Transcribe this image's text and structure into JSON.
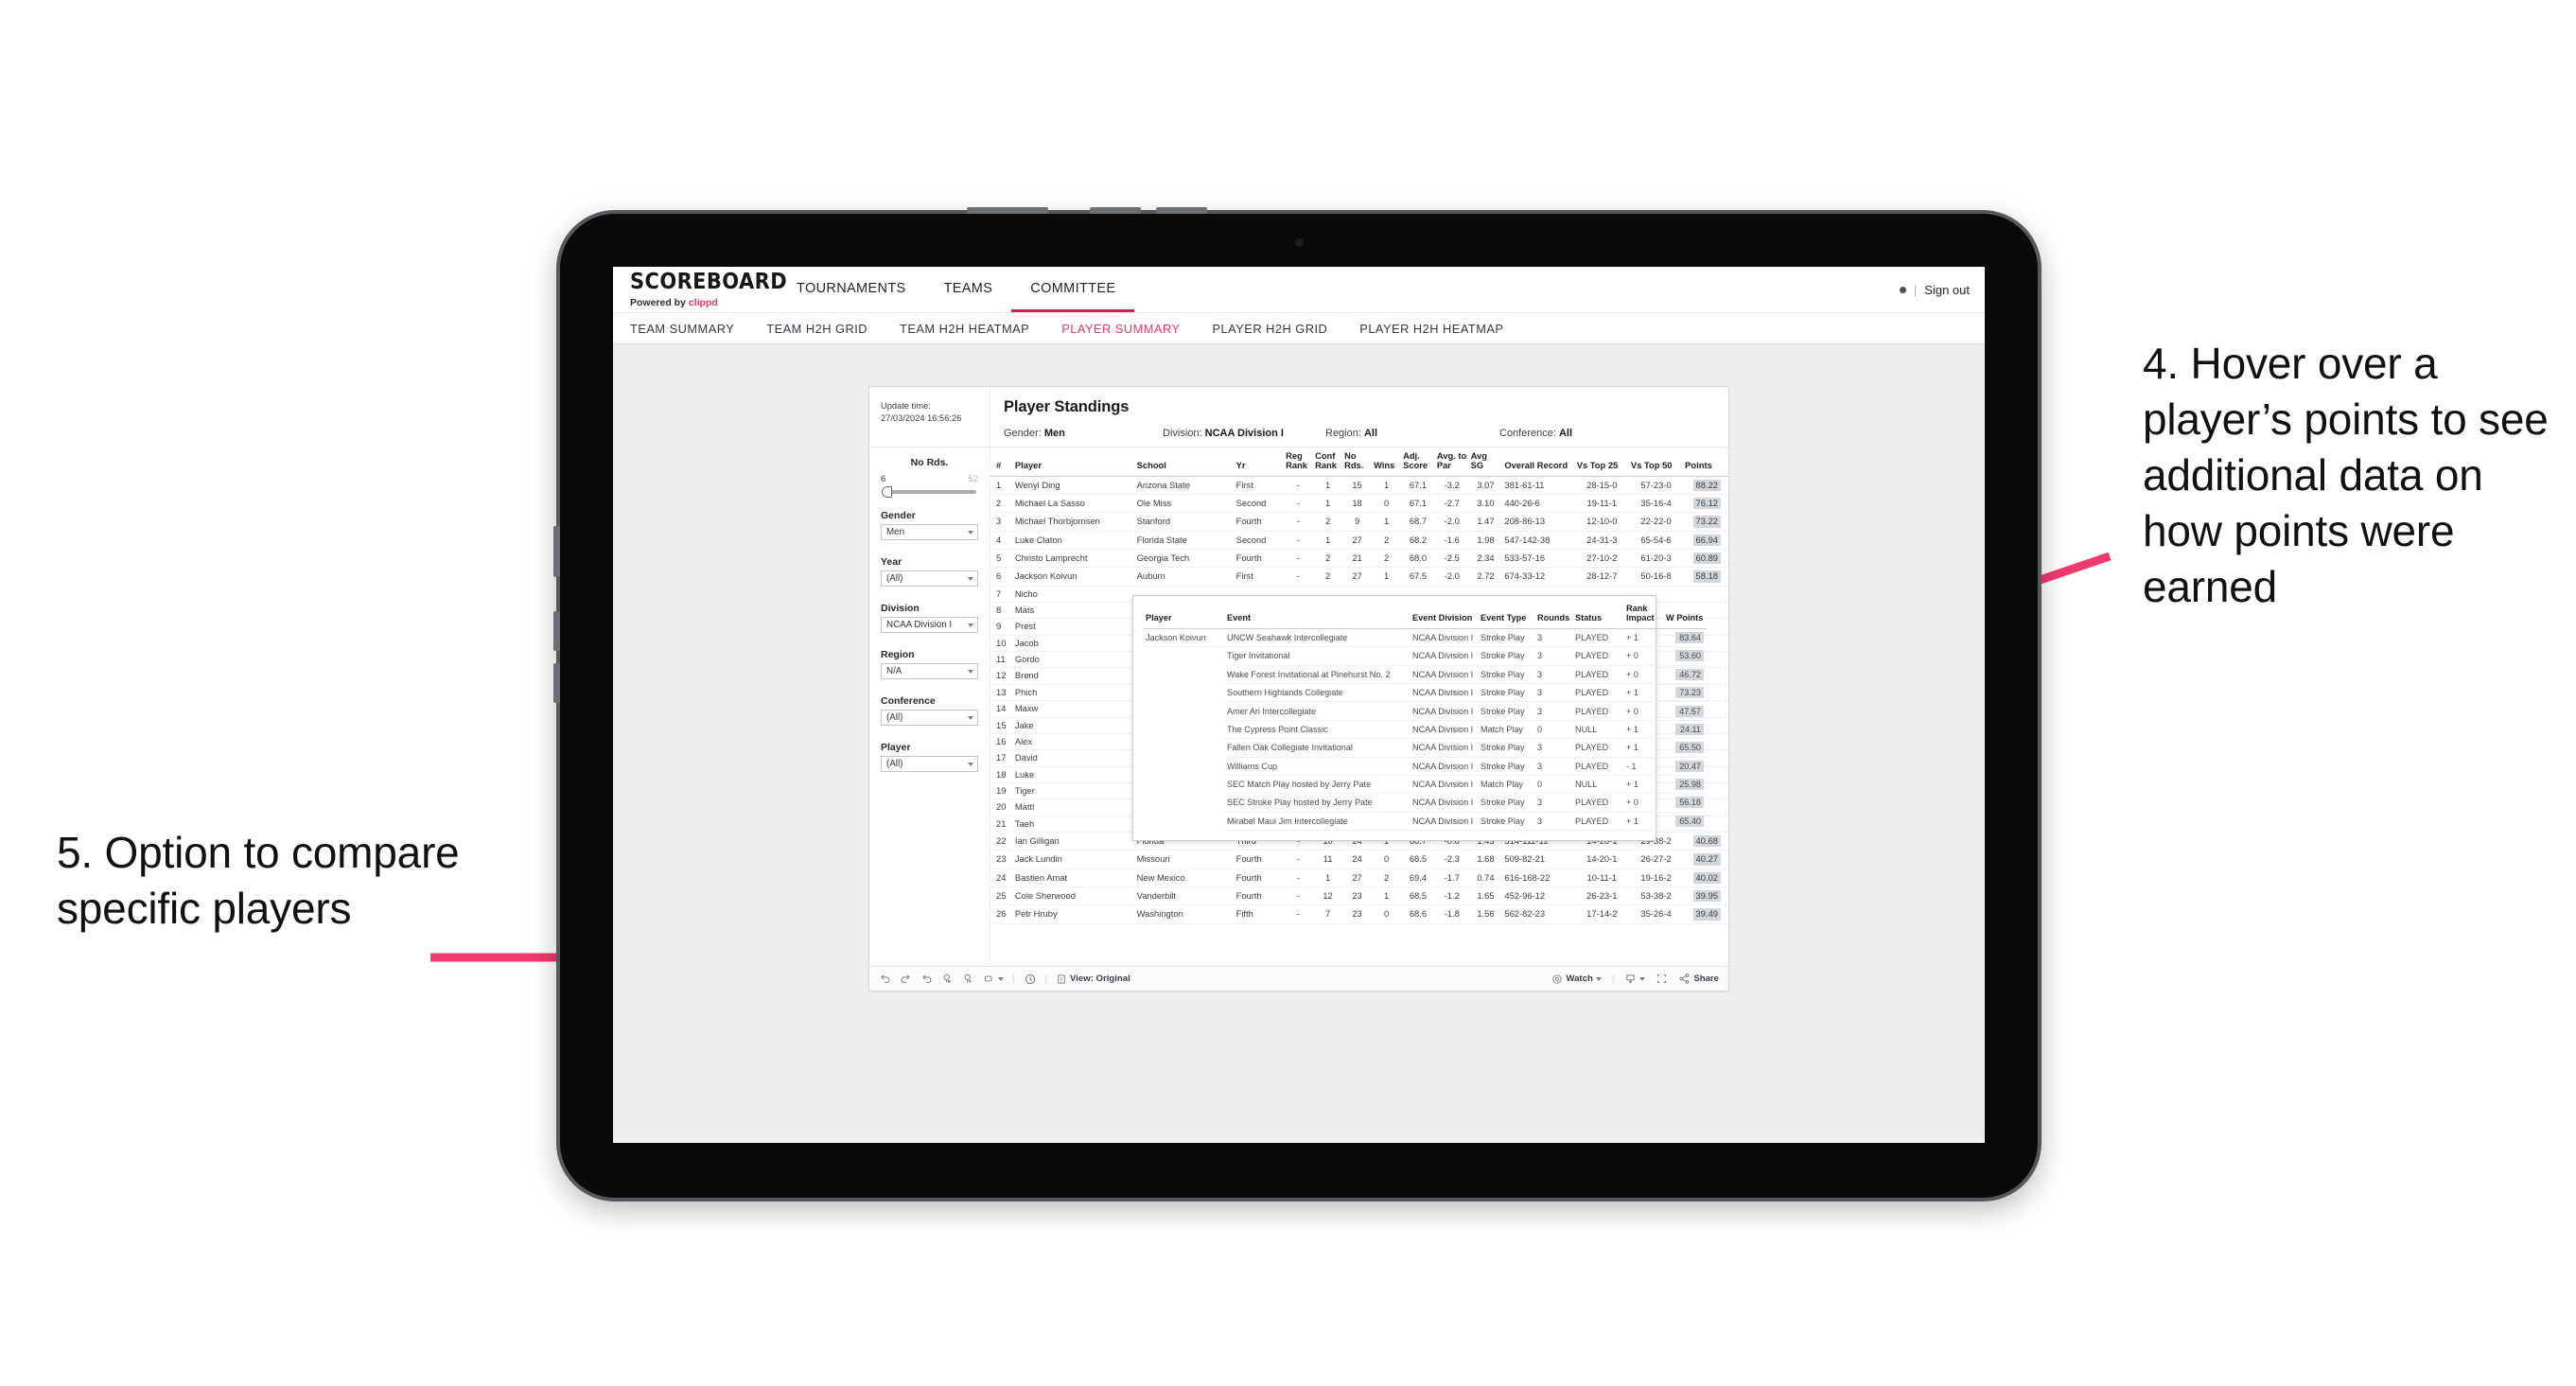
{
  "slide": {
    "annotations": [
      {
        "id": "annot-left",
        "text": "5. Option to compare specific players"
      },
      {
        "id": "annot-right",
        "text": "4. Hover over a player’s points to see additional data on how points were earned"
      }
    ],
    "arrow_color": "#ef3a6e"
  },
  "header": {
    "brand_word": "SCOREBOARD",
    "brand_powered_prefix": "Powered by ",
    "brand_powered_name": "clippd",
    "nav": [
      {
        "label": "TOURNAMENTS",
        "active": false
      },
      {
        "label": "TEAMS",
        "active": false
      },
      {
        "label": "COMMITTEE",
        "active": true
      }
    ],
    "separator": "|",
    "sign_out": "Sign out"
  },
  "subnav": [
    {
      "label": "TEAM SUMMARY",
      "active": false
    },
    {
      "label": "TEAM H2H GRID",
      "active": false
    },
    {
      "label": "TEAM H2H HEATMAP",
      "active": false
    },
    {
      "label": "PLAYER SUMMARY",
      "active": true
    },
    {
      "label": "PLAYER H2H GRID",
      "active": false
    },
    {
      "label": "PLAYER H2H HEATMAP",
      "active": false
    }
  ],
  "viz": {
    "update_label": "Update time:",
    "update_value": "27/03/2024 16:56:26",
    "title": "Player Standings",
    "summary": [
      {
        "label": "Gender: ",
        "value": "Men"
      },
      {
        "label": "Division: ",
        "value": "NCAA Division I"
      },
      {
        "label": "Region: ",
        "value": "All"
      },
      {
        "label": "Conference: ",
        "value": "All"
      }
    ]
  },
  "filters": {
    "slider": {
      "title": "No Rds.",
      "min": "6",
      "max": "52"
    },
    "groups": [
      {
        "label": "Gender",
        "value": "Men"
      },
      {
        "label": "Year",
        "value": "(All)"
      },
      {
        "label": "Division",
        "value": "NCAA Division I"
      },
      {
        "label": "Region",
        "value": "N/A"
      },
      {
        "label": "Conference",
        "value": "(All)"
      },
      {
        "label": "Player",
        "value": "(All)"
      }
    ]
  },
  "table": {
    "columns": [
      "#",
      "Player",
      "School",
      "Yr",
      "Reg Rank",
      "Conf Rank",
      "No Rds.",
      "Wins",
      "Adj. Score",
      "Avg. to Par",
      "Avg SG",
      "Overall Record",
      "Vs Top 25",
      "Vs Top 50",
      "Points"
    ],
    "rows": [
      {
        "num": "1",
        "player": "Wenyi Ding",
        "school": "Arizona State",
        "yr": "First",
        "reg": "-",
        "conf": "1",
        "rds": "15",
        "wins": "1",
        "adj": "67.1",
        "par": "-3.2",
        "sg": "3.07",
        "record": "381-61-11",
        "t25": "28-15-0",
        "t50": "57-23-0",
        "points": "88.22"
      },
      {
        "num": "2",
        "player": "Michael La Sasso",
        "school": "Ole Miss",
        "yr": "Second",
        "reg": "-",
        "conf": "1",
        "rds": "18",
        "wins": "0",
        "adj": "67.1",
        "par": "-2.7",
        "sg": "3.10",
        "record": "440-26-6",
        "t25": "19-11-1",
        "t50": "35-16-4",
        "points": "76.12"
      },
      {
        "num": "3",
        "player": "Michael Thorbjornsen",
        "school": "Stanford",
        "yr": "Fourth",
        "reg": "-",
        "conf": "2",
        "rds": "9",
        "wins": "1",
        "adj": "68.7",
        "par": "-2.0",
        "sg": "1.47",
        "record": "208-86-13",
        "t25": "12-10-0",
        "t50": "22-22-0",
        "points": "73.22"
      },
      {
        "num": "4",
        "player": "Luke Claton",
        "school": "Florida State",
        "yr": "Second",
        "reg": "-",
        "conf": "1",
        "rds": "27",
        "wins": "2",
        "adj": "68.2",
        "par": "-1.6",
        "sg": "1.98",
        "record": "547-142-38",
        "t25": "24-31-3",
        "t50": "65-54-6",
        "points": "66.94"
      },
      {
        "num": "5",
        "player": "Christo Lamprecht",
        "school": "Georgia Tech",
        "yr": "Fourth",
        "reg": "-",
        "conf": "2",
        "rds": "21",
        "wins": "2",
        "adj": "68.0",
        "par": "-2.5",
        "sg": "2.34",
        "record": "533-57-16",
        "t25": "27-10-2",
        "t50": "61-20-3",
        "points": "60.89"
      },
      {
        "num": "6",
        "player": "Jackson Koivun",
        "school": "Auburn",
        "yr": "First",
        "reg": "-",
        "conf": "2",
        "rds": "27",
        "wins": "1",
        "adj": "67.5",
        "par": "-2.0",
        "sg": "2.72",
        "record": "674-33-12",
        "t25": "28-12-7",
        "t50": "50-16-8",
        "points": "58.18"
      }
    ],
    "obscured_rows": [
      {
        "num": "7",
        "player": "Nicho"
      },
      {
        "num": "8",
        "player": "Mats"
      },
      {
        "num": "9",
        "player": "Prest"
      },
      {
        "num": "10",
        "player": "Jacob"
      },
      {
        "num": "11",
        "player": "Gordo"
      },
      {
        "num": "12",
        "player": "Brend"
      },
      {
        "num": "13",
        "player": "Phich"
      },
      {
        "num": "14",
        "player": "Maxw"
      },
      {
        "num": "15",
        "player": "Jake "
      },
      {
        "num": "16",
        "player": "Alex "
      },
      {
        "num": "17",
        "player": "David"
      },
      {
        "num": "18",
        "player": "Luke "
      },
      {
        "num": "19",
        "player": "Tiger"
      },
      {
        "num": "20",
        "player": "Mattl"
      },
      {
        "num": "21",
        "player": "Taeh"
      }
    ],
    "bottom_rows": [
      {
        "num": "22",
        "player": "Ian Gilligan",
        "school": "Florida",
        "yr": "Third",
        "reg": "-",
        "conf": "10",
        "rds": "24",
        "wins": "1",
        "adj": "68.7",
        "par": "-0.8",
        "sg": "1.43",
        "record": "514-111-12",
        "t25": "14-26-1",
        "t50": "29-38-2",
        "points": "40.68"
      },
      {
        "num": "23",
        "player": "Jack Lundin",
        "school": "Missouri",
        "yr": "Fourth",
        "reg": "-",
        "conf": "11",
        "rds": "24",
        "wins": "0",
        "adj": "68.5",
        "par": "-2.3",
        "sg": "1.68",
        "record": "509-82-21",
        "t25": "14-20-1",
        "t50": "26-27-2",
        "points": "40.27"
      },
      {
        "num": "24",
        "player": "Bastien Amat",
        "school": "New Mexico",
        "yr": "Fourth",
        "reg": "-",
        "conf": "1",
        "rds": "27",
        "wins": "2",
        "adj": "69.4",
        "par": "-1.7",
        "sg": "0.74",
        "record": "616-168-22",
        "t25": "10-11-1",
        "t50": "19-16-2",
        "points": "40.02"
      },
      {
        "num": "25",
        "player": "Cole Sherwood",
        "school": "Vanderbilt",
        "yr": "Fourth",
        "reg": "-",
        "conf": "12",
        "rds": "23",
        "wins": "1",
        "adj": "68.5",
        "par": "-1.2",
        "sg": "1.65",
        "record": "452-96-12",
        "t25": "26-23-1",
        "t50": "53-38-2",
        "points": "39.95"
      },
      {
        "num": "26",
        "player": "Petr Hruby",
        "school": "Washington",
        "yr": "Fifth",
        "reg": "-",
        "conf": "7",
        "rds": "23",
        "wins": "0",
        "adj": "68.6",
        "par": "-1.8",
        "sg": "1.56",
        "record": "562-82-23",
        "t25": "17-14-2",
        "t50": "35-26-4",
        "points": "39.49"
      }
    ]
  },
  "tooltip": {
    "columns": [
      "Player",
      "Event",
      "Event Division",
      "Event Type",
      "Rounds",
      "Status",
      "Rank Impact",
      "W Points"
    ],
    "player": "Jackson Koivun",
    "rows": [
      {
        "event": "UNCW Seahawk Intercollegiate",
        "division": "NCAA Division I",
        "type": "Stroke Play",
        "rounds": "3",
        "status": "PLAYED",
        "impact": "+ 1",
        "wpoints": "83.64"
      },
      {
        "event": "Tiger Invitational",
        "division": "NCAA Division I",
        "type": "Stroke Play",
        "rounds": "3",
        "status": "PLAYED",
        "impact": "+ 0",
        "wpoints": "53.60"
      },
      {
        "event": "Wake Forest Invitational at Pinehurst No. 2",
        "division": "NCAA Division I",
        "type": "Stroke Play",
        "rounds": "3",
        "status": "PLAYED",
        "impact": "+ 0",
        "wpoints": "46.72"
      },
      {
        "event": "Southern Highlands Collegiate",
        "division": "NCAA Division I",
        "type": "Stroke Play",
        "rounds": "3",
        "status": "PLAYED",
        "impact": "+ 1",
        "wpoints": "73.23"
      },
      {
        "event": "Amer Ari Intercollegiate",
        "division": "NCAA Division I",
        "type": "Stroke Play",
        "rounds": "3",
        "status": "PLAYED",
        "impact": "+ 0",
        "wpoints": "47.57"
      },
      {
        "event": "The Cypress Point Classic",
        "division": "NCAA Division I",
        "type": "Match Play",
        "rounds": "0",
        "status": "NULL",
        "impact": "+ 1",
        "wpoints": "24.11"
      },
      {
        "event": "Fallen Oak Collegiate Invitational",
        "division": "NCAA Division I",
        "type": "Stroke Play",
        "rounds": "3",
        "status": "PLAYED",
        "impact": "+ 1",
        "wpoints": "65.50"
      },
      {
        "event": "Williams Cup",
        "division": "NCAA Division I",
        "type": "Stroke Play",
        "rounds": "3",
        "status": "PLAYED",
        "impact": "- 1",
        "wpoints": "20.47"
      },
      {
        "event": "SEC Match Play hosted by Jerry Pate",
        "division": "NCAA Division I",
        "type": "Match Play",
        "rounds": "0",
        "status": "NULL",
        "impact": "+ 1",
        "wpoints": "25.98"
      },
      {
        "event": "SEC Stroke Play hosted by Jerry Pate",
        "division": "NCAA Division I",
        "type": "Stroke Play",
        "rounds": "3",
        "status": "PLAYED",
        "impact": "+ 0",
        "wpoints": "56.18"
      },
      {
        "event": "Mirabel Maui Jim Intercollegiate",
        "division": "NCAA Division I",
        "type": "Stroke Play",
        "rounds": "3",
        "status": "PLAYED",
        "impact": "+ 1",
        "wpoints": "65.40"
      }
    ]
  },
  "toolbar": {
    "view_label": "View: Original",
    "watch_label": "Watch",
    "share_label": "Share"
  }
}
